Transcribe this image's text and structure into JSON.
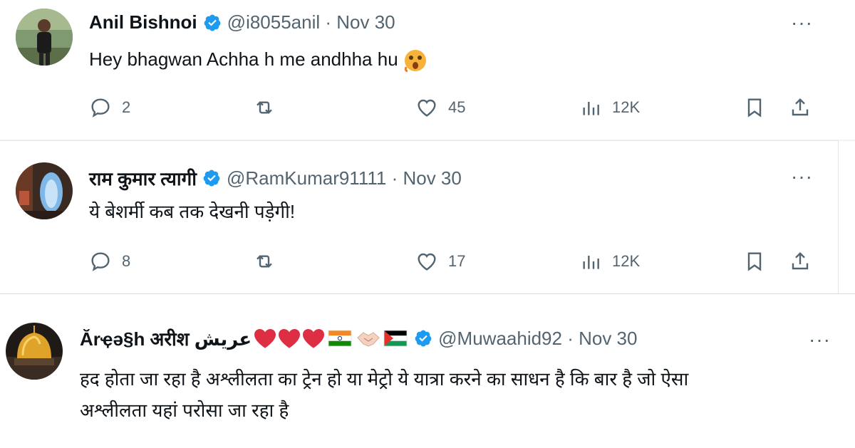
{
  "tweets": [
    {
      "name": "Anil Bishnoi",
      "handle": "@i8055anil · Nov 30",
      "text": "Hey bhagwan Achha h me andhha hu",
      "more": "···",
      "replies": "2",
      "reposts": "",
      "likes": "45",
      "views": "12K"
    },
    {
      "name": "राम कुमार त्यागी",
      "handle": "@RamKumar91111 · Nov 30",
      "text": "ये बेशर्मी कब तक देखनी पड़ेगी!",
      "more": "···",
      "replies": "8",
      "reposts": "",
      "likes": "17",
      "views": "12K"
    },
    {
      "name": "Ărҿə§h अरीश عريش",
      "handle": "@Muwaahid92 · Nov 30",
      "text_line1": "हद होता जा रहा है अश्लीलता का ट्रेन हो या मेट्रो ये यात्रा करने का साधन है कि बार है जो ऐसा",
      "text_line2": "अश्लीलता यहां परोसा जा रहा है",
      "more": "···"
    }
  ],
  "colors": {
    "text": "#0f1419",
    "secondary": "#536471",
    "verified": "#1d9bf0",
    "divider": "#eff3f4"
  },
  "icons": [
    "reply-icon",
    "repost-icon",
    "like-icon",
    "views-icon",
    "bookmark-icon",
    "share-icon",
    "verified-badge-icon",
    "more-icon"
  ]
}
